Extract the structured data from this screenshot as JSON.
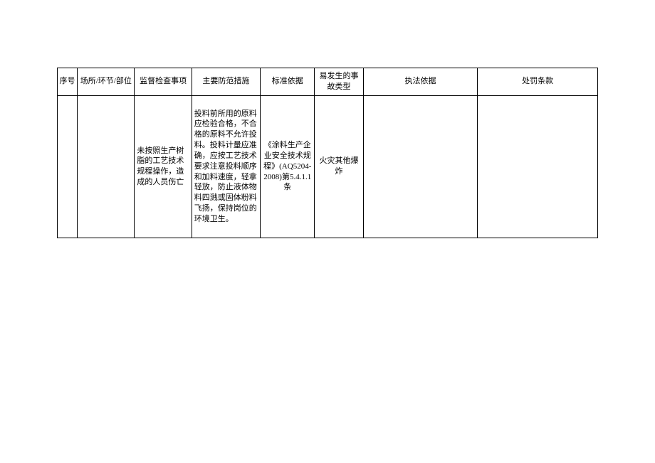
{
  "headers": {
    "seq": "序号",
    "place": "场所/环节/部位",
    "inspect": "监督检查事项",
    "prevent": "主要防范措施",
    "standard": "标准依据",
    "accident": "易发生的事故类型",
    "law": "执法依据",
    "penalty": "处罚条款"
  },
  "rows": [
    {
      "seq": "",
      "place": "",
      "inspect": "未按照生产树脂的工艺技术规程操作，造成的人员伤亡",
      "prevent": "投料前所用的原料应检验合格，不合格的原料不允许投料。投料计量应准确，应按工艺技术要求注意投料顺序和加料速度，轻拿轻放，防止液体物料四溅或固体粉料飞扬，保持岗位的环境卫生。",
      "standard": "《涂料生产企业安全技术规程》(AQ5204-2008)第5.4.1.1条",
      "accident": "火灾其他爆炸",
      "law": "",
      "penalty": ""
    }
  ]
}
